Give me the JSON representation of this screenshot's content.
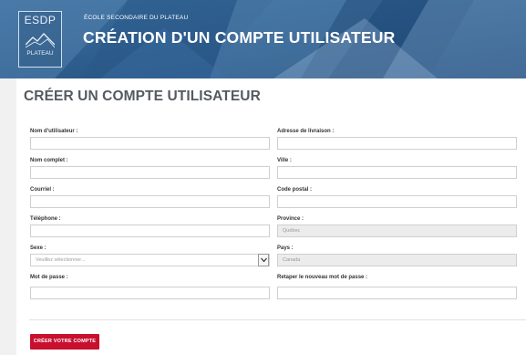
{
  "header": {
    "logo_text": "ESDP",
    "logo_subtext": "PLATEAU",
    "school_name": "ÉCOLE SECONDAIRE DU PLATEAU",
    "app_title": "CRÉATION D'UN COMPTE UTILISATEUR"
  },
  "form": {
    "title": "CRÉER UN COMPTE UTILISATEUR",
    "fields": {
      "username": {
        "label": "Nom d'utilisateur :",
        "value": ""
      },
      "fullname": {
        "label": "Nom complet :",
        "value": ""
      },
      "email": {
        "label": "Courriel :",
        "value": ""
      },
      "phone": {
        "label": "Téléphone :",
        "value": ""
      },
      "sex": {
        "label": "Sexe :",
        "value": "Veuillez sélectionner..."
      },
      "password": {
        "label": "Mot de passe :",
        "value": ""
      },
      "address": {
        "label": "Adresse de livraison :",
        "value": ""
      },
      "city": {
        "label": "Ville :",
        "value": ""
      },
      "postal": {
        "label": "Code postal :",
        "value": ""
      },
      "province": {
        "label": "Province :",
        "value": "Québec"
      },
      "country": {
        "label": "Pays :",
        "value": "Canada"
      },
      "password_confirm": {
        "label": "Retaper le nouveau mot de passe :",
        "value": ""
      }
    },
    "submit_label": "CRÉER VOTRE COMPTE"
  },
  "colors": {
    "banner": "#2f5f8f",
    "accent": "#c8102e",
    "title": "#555a60"
  }
}
